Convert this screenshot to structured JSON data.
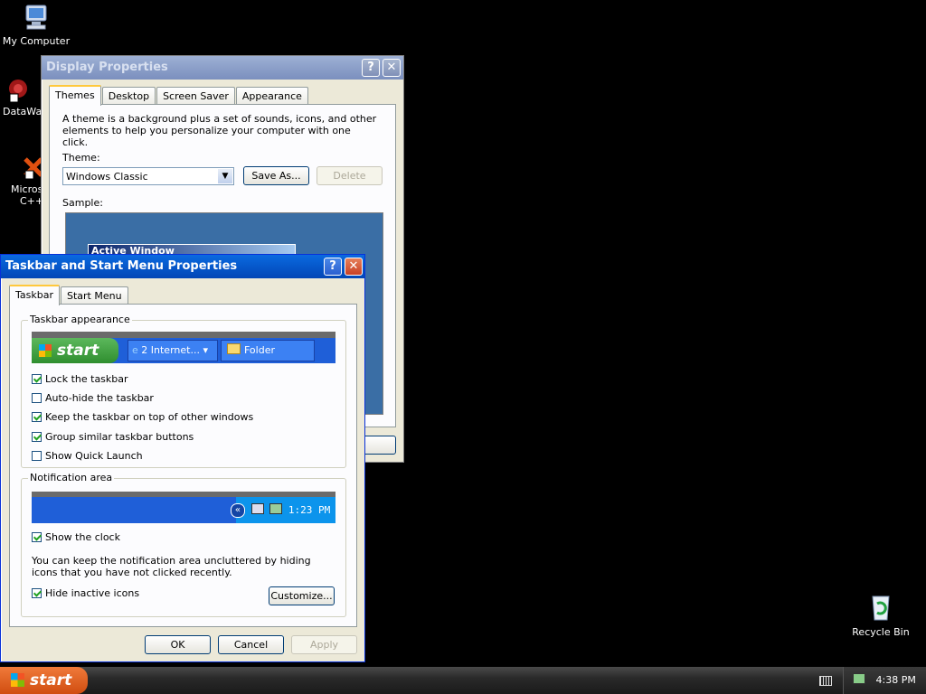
{
  "desktop": {
    "icons": [
      {
        "label": "My Computer",
        "icon": "my-computer-icon"
      },
      {
        "label": "DataWa",
        "icon": "datawa-icon"
      },
      {
        "label": "Microsoft",
        "label2": "C++",
        "icon": "cpp-icon"
      },
      {
        "label": "Recycle Bin",
        "icon": "recycle-bin-icon"
      }
    ]
  },
  "display_properties": {
    "title": "Display Properties",
    "tabs": [
      "Themes",
      "Desktop",
      "Screen Saver",
      "Appearance"
    ],
    "description": "A theme is a background plus a set of sounds, icons, and other elements to help you personalize your computer with one click.",
    "theme_label": "Theme:",
    "theme_value": "Windows Classic",
    "save_as": "Save As...",
    "delete": "Delete",
    "sample_label": "Sample:",
    "sample_window_title": "Active Window",
    "apply_partial": "ply"
  },
  "taskbar_props": {
    "title": "Taskbar and Start Menu Properties",
    "tabs": [
      "Taskbar",
      "Start Menu"
    ],
    "appearance_group": "Taskbar appearance",
    "preview": {
      "start": "start",
      "item1": "2 Internet...",
      "item2": "Folder"
    },
    "options": [
      {
        "label": "Lock the taskbar",
        "checked": true
      },
      {
        "label": "Auto-hide the taskbar",
        "checked": false
      },
      {
        "label": "Keep the taskbar on top of other windows",
        "checked": true
      },
      {
        "label": "Group similar taskbar buttons",
        "checked": true
      },
      {
        "label": "Show Quick Launch",
        "checked": false
      }
    ],
    "notification_group": "Notification area",
    "notif_time": "1:23 PM",
    "show_clock": {
      "label": "Show the clock",
      "checked": true
    },
    "notif_text": "You can keep the notification area uncluttered by hiding icons that you have not clicked recently.",
    "hide_inactive": {
      "label": "Hide inactive icons",
      "checked": true
    },
    "customize": "Customize...",
    "ok": "OK",
    "cancel": "Cancel",
    "apply": "Apply"
  },
  "taskbar": {
    "start": "start",
    "clock": "4:38 PM"
  }
}
